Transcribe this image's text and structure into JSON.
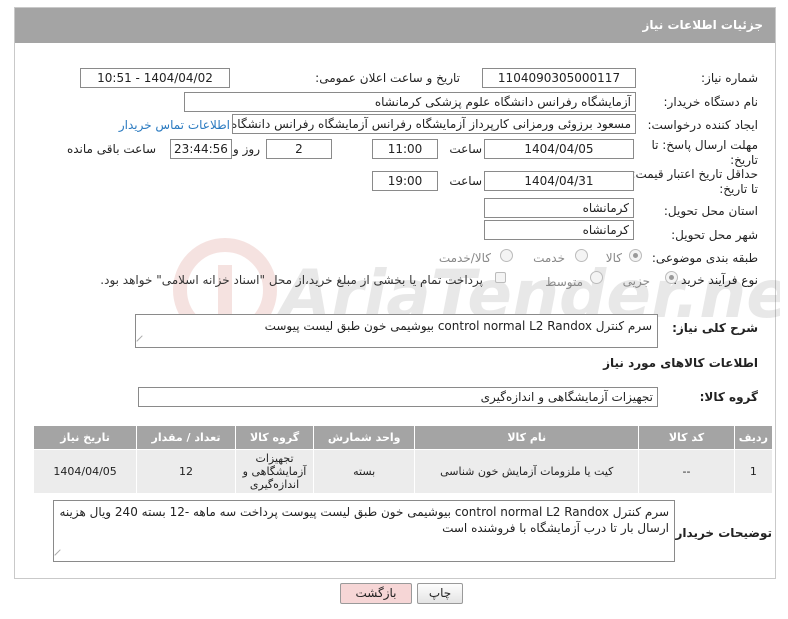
{
  "header": {
    "title": "جزئیات اطلاعات نیاز"
  },
  "form": {
    "need_number_label": "شماره نیاز:",
    "need_number": "1104090305000117",
    "announce_label": "تاریخ و ساعت اعلان عمومی:",
    "announce_value": "1404/04/02 - 10:51",
    "buyer_org_label": "نام دستگاه خریدار:",
    "buyer_org": "آزمایشگاه رفرانس دانشگاه علوم پزشکی کرمانشاه",
    "creator_label": "ایجاد کننده درخواست:",
    "creator": "مسعود برزوئی ورمزانی کارپرداز آزمایشگاه رفرانس آزمایشگاه رفرانس دانشگاه ع",
    "contact_link": "اطلاعات تماس خریدار",
    "deadline_label_1": "مهلت ارسال پاسخ: تا",
    "deadline_label_2": "تاریخ:",
    "deadline_date": "1404/04/05",
    "time_label": "ساعت",
    "deadline_time": "11:00",
    "days_value": "2",
    "days_label": "روز و",
    "remaining_time": "23:44:56",
    "remaining_label": "ساعت باقی مانده",
    "validity_label_1": "حداقل تاریخ اعتبار قیمت:",
    "validity_label_2": "تا تاریخ:",
    "validity_date": "1404/04/31",
    "validity_time": "19:00",
    "province_label": "استان محل تحویل:",
    "province": "کرمانشاه",
    "city_label": "شهر محل تحویل:",
    "city": "کرمانشاه",
    "category_label": "طبقه بندی موضوعی:",
    "category_options": [
      "کالا",
      "خدمت",
      "کالا/خدمت"
    ],
    "process_label": "نوع فرآیند خرید :",
    "process_options": [
      "جزیی",
      "متوسط"
    ],
    "payment_note": "پرداخت تمام یا بخشی از مبلغ خرید،از محل \"اسناد خزانه اسلامی\" خواهد بود.",
    "summary_label": "شرح کلی نیاز:",
    "summary": "سرم کنترل control normal L2 Randox بیوشیمی خون طبق لیست پیوست",
    "goods_info_title": "اطلاعات کالاهای مورد نیاز",
    "goods_group_label": "گروه کالا:",
    "goods_group": "تجهیزات آزمایشگاهی و اندازه‌گیری"
  },
  "table": {
    "headers": [
      "ردیف",
      "کد کالا",
      "نام کالا",
      "واحد شمارش",
      "گروه کالا",
      "تعداد / مقدار",
      "تاریخ نیاز"
    ],
    "rows": [
      [
        "1",
        "--",
        "کیت یا ملزومات آزمایش خون شناسی",
        "بسته",
        "تجهیزات آزمایشگاهی و اندازه‌گیری",
        "12",
        "1404/04/05"
      ]
    ]
  },
  "buyer_notes_label": "توضیحات خریدار:",
  "buyer_notes": "سرم کنترل control normal L2 Randox بیوشیمی خون طبق لیست پیوست پرداخت سه ماهه -12 بسته 240 ویال هزینه ارسال بار تا درب آزمایشگاه با فروشنده است",
  "buttons": {
    "print": "چاپ",
    "back": "بازگشت"
  },
  "watermark_text": "AriaTender.net",
  "colors": {
    "header_bg": "#a4a4a4",
    "link": "#2a7ac0",
    "back_button_bg": "#f6d6d6"
  }
}
